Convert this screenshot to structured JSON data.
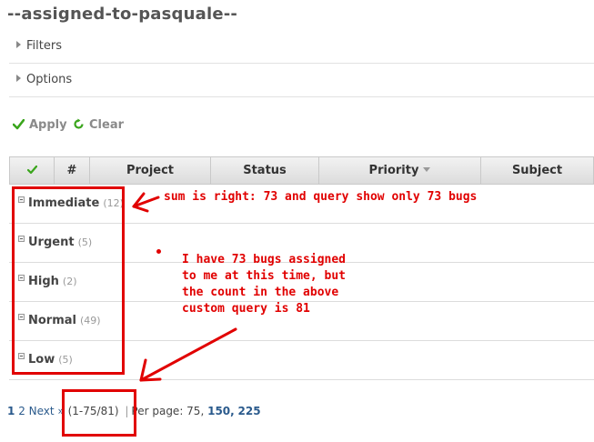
{
  "page": {
    "title": "--assigned-to-pasquale--"
  },
  "fieldsets": {
    "filters_label": "Filters",
    "options_label": "Options"
  },
  "actions": {
    "apply_label": "Apply",
    "clear_label": "Clear"
  },
  "table": {
    "columns": [
      {
        "key": "check",
        "label": ""
      },
      {
        "key": "id",
        "label": "#"
      },
      {
        "key": "project",
        "label": "Project"
      },
      {
        "key": "status",
        "label": "Status"
      },
      {
        "key": "priority",
        "label": "Priority",
        "sorted": "desc"
      },
      {
        "key": "subject",
        "label": "Subject"
      }
    ],
    "groups": [
      {
        "name": "Immediate",
        "count": "(12)"
      },
      {
        "name": "Urgent",
        "count": "(5)"
      },
      {
        "name": "High",
        "count": "(2)"
      },
      {
        "name": "Normal",
        "count": "(49)"
      },
      {
        "name": "Low",
        "count": "(5)"
      }
    ]
  },
  "pagination": {
    "page1": "1",
    "page2": "2",
    "next": "Next »",
    "range": "(1-75/81)",
    "per_page_label": "Per page: 75,",
    "option_150": "150,",
    "option_225": "225"
  },
  "annotations": {
    "note1": "sum is right: 73 and query show only 73 bugs",
    "note2": "I have 73 bugs assigned\nto me at this time, but\nthe count in the above\ncustom query is 81",
    "color": "#e10000"
  },
  "colors": {
    "check_green": "#3aa51c",
    "clear_green": "#3aa51c",
    "link_blue": "#2a5a8c"
  }
}
